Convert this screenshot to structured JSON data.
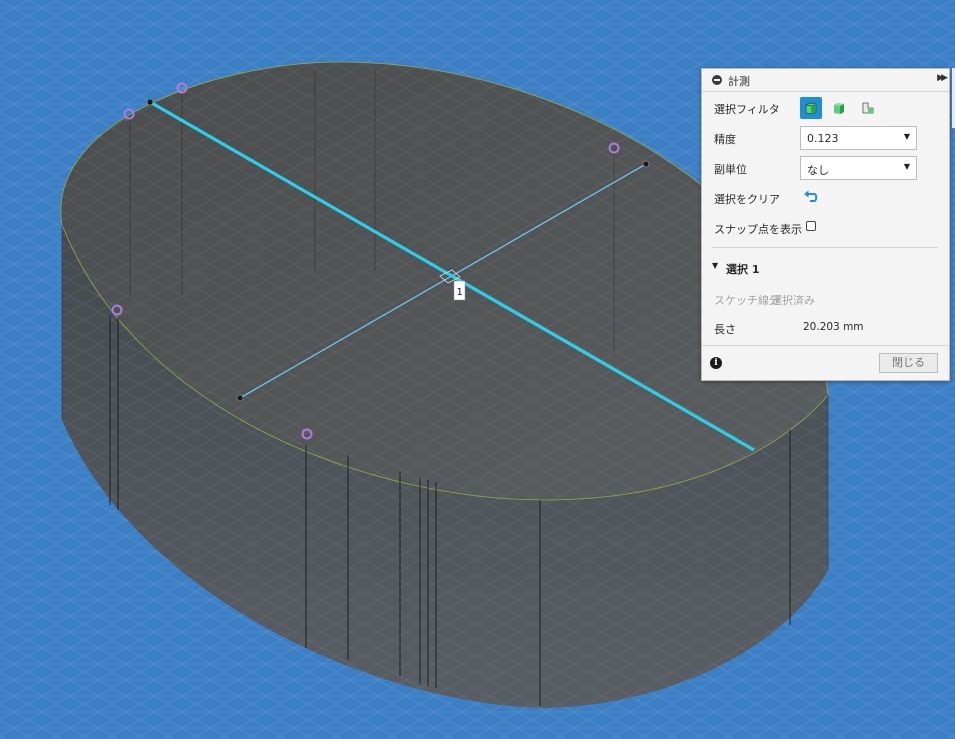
{
  "viewport": {
    "dimension_label": "1",
    "colors": {
      "background": "#3d7fc4",
      "body_face": "#505354",
      "measure_line": "#2ad0ea",
      "snap_point": "#b07be0"
    }
  },
  "measure_panel": {
    "title": "計測",
    "collapse_icon": "minus-circle-icon",
    "expand_icon": "double-chevron-right-icon",
    "selection_filter": {
      "label": "選択フィルタ",
      "buttons": [
        {
          "icon": "body-filter-icon",
          "active": true
        },
        {
          "icon": "face-filter-icon",
          "active": false
        },
        {
          "icon": "edge-filter-icon",
          "active": false
        }
      ]
    },
    "precision": {
      "label": "精度",
      "value": "0.123"
    },
    "secondary_units": {
      "label": "副単位",
      "value": "なし"
    },
    "clear_selection": {
      "label": "選択をクリア",
      "icon": "undo-icon"
    },
    "show_snap_points": {
      "label": "スナップ点を表示",
      "checked": false
    },
    "selection_section": {
      "title": "選択 1",
      "item_type": "スケッチ線分",
      "item_status": "選択済み",
      "length_label": "長さ",
      "length_value": "20.203 mm"
    },
    "close_label": "閉じる",
    "accent_color": "#1f8ed6"
  }
}
